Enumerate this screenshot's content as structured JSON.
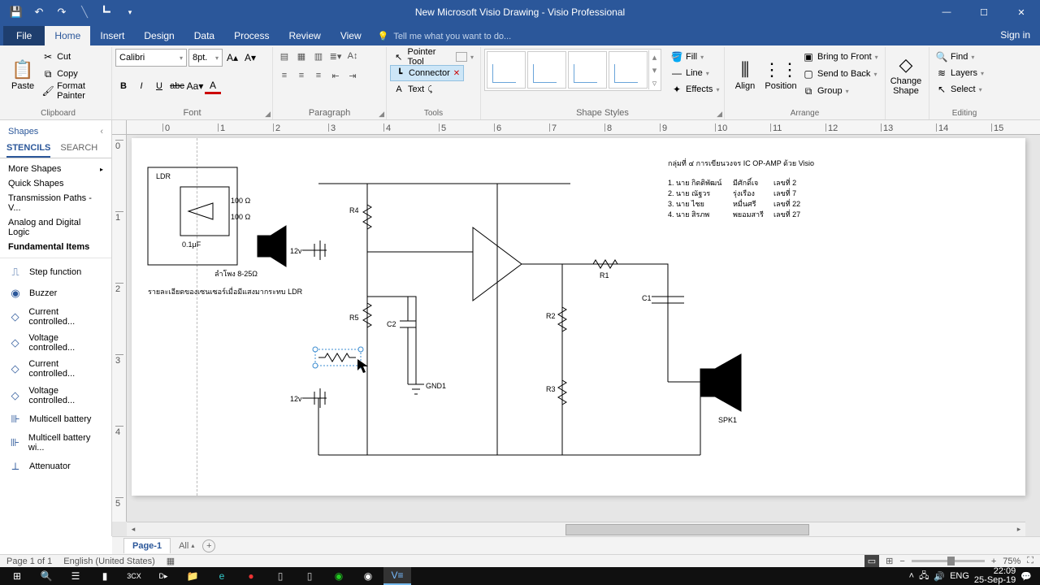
{
  "titlebar": {
    "title": "New Microsoft Visio Drawing - Visio Professional"
  },
  "menu": {
    "file": "File",
    "tabs": [
      "Home",
      "Insert",
      "Design",
      "Data",
      "Process",
      "Review",
      "View"
    ],
    "tellme": "Tell me what you want to do...",
    "signin": "Sign in"
  },
  "ribbon": {
    "clipboard": {
      "paste": "Paste",
      "cut": "Cut",
      "copy": "Copy",
      "painter": "Format Painter",
      "label": "Clipboard"
    },
    "font": {
      "family": "Calibri",
      "size": "8pt.",
      "label": "Font"
    },
    "paragraph": {
      "label": "Paragraph"
    },
    "tools": {
      "pointer": "Pointer Tool",
      "connector": "Connector",
      "text": "Text",
      "label": "Tools"
    },
    "styles": {
      "label": "Shape Styles",
      "fill": "Fill",
      "line": "Line",
      "effects": "Effects"
    },
    "arrange": {
      "align": "Align",
      "position": "Position",
      "bringfront": "Bring to Front",
      "sendback": "Send to Back",
      "group": "Group",
      "label": "Arrange"
    },
    "change": {
      "label": "Change Shape"
    },
    "editing": {
      "find": "Find",
      "layers": "Layers",
      "select": "Select",
      "label": "Editing"
    }
  },
  "shapes": {
    "title": "Shapes",
    "stencils": "STENCILS",
    "search": "SEARCH",
    "more": "More Shapes",
    "quick": "Quick Shapes",
    "stencilList": [
      "Transmission Paths - V...",
      "Analog and Digital Logic",
      "Fundamental Items"
    ],
    "items": [
      {
        "icon": "⎍",
        "label": "Step function"
      },
      {
        "icon": "◉",
        "label": "Buzzer"
      },
      {
        "icon": "◇",
        "label": "Current controlled..."
      },
      {
        "icon": "◇",
        "label": "Voltage controlled..."
      },
      {
        "icon": "◇",
        "label": "Current controlled..."
      },
      {
        "icon": "◇",
        "label": "Voltage controlled..."
      },
      {
        "icon": "⊪",
        "label": "Multicell battery"
      },
      {
        "icon": "⊪",
        "label": "Multicell battery wi..."
      },
      {
        "icon": "⟂",
        "label": "Attenuator"
      }
    ]
  },
  "ruler_h": [
    "0",
    "1",
    "2",
    "3",
    "4",
    "5",
    "6",
    "7",
    "8",
    "9",
    "10",
    "11",
    "12",
    "13",
    "14",
    "15"
  ],
  "ruler_v": [
    "0",
    "1",
    "2",
    "3",
    "4",
    "5"
  ],
  "circuit": {
    "labels": {
      "R1": "R1",
      "R2": "R2",
      "R3": "R3",
      "R4": "R4",
      "R5": "R5",
      "C1": "C1",
      "C2": "C2",
      "GND1": "GND1",
      "SPK1": "SPK1",
      "v12a": "12v",
      "v12b": "12v"
    },
    "caption": "รายละเอียดของเซนเซอร์เมื่อมีแสงมากระทบ LDR",
    "heading": "กลุ่มที่ ๔   การเขียนวงจร IC OP-AMP ด้วย Visio",
    "rows": [
      [
        "1. นาย กิตติพัฒน์",
        "มีศักดิ์เจ",
        "เลขที่ 2"
      ],
      [
        "2. นาย ณัฐวร",
        "รุ่งเรือง",
        "เลขที่ 7"
      ],
      [
        "3. นาย ไชย",
        "หมื่นศรี",
        "เลขที่ 22"
      ],
      [
        "4. นาย สิรภพ",
        "พยอมสารี",
        "เลขที่ 27"
      ]
    ]
  },
  "pagetabs": {
    "page1": "Page-1",
    "all": "All"
  },
  "status": {
    "pages": "Page 1 of 1",
    "lang": "English (United States)",
    "zoom": "75%"
  },
  "taskbar": {
    "lang": "ENG",
    "time": "22:09",
    "date": "25-Sep-19"
  }
}
